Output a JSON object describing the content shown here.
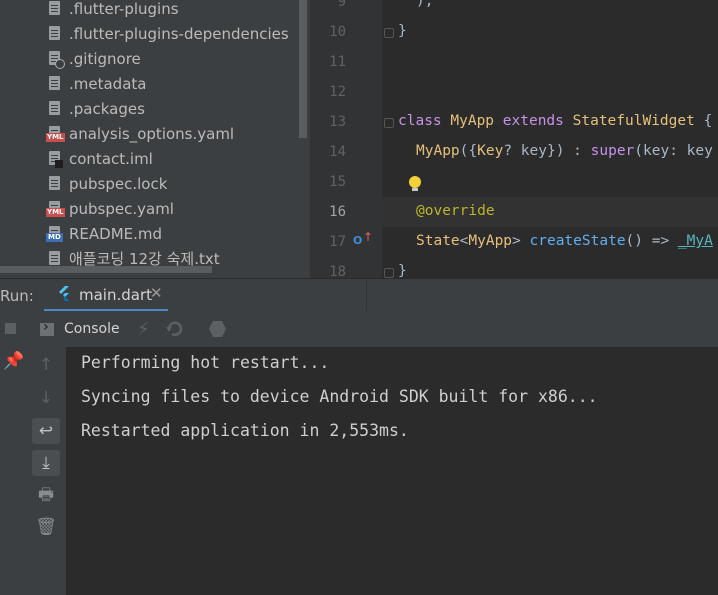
{
  "project_tree": {
    "items": [
      {
        "label": ".flutter-plugins",
        "icon": "file-icon"
      },
      {
        "label": ".flutter-plugins-dependencies",
        "icon": "file-icon"
      },
      {
        "label": ".gitignore",
        "icon": "gitignore-file-icon"
      },
      {
        "label": ".metadata",
        "icon": "file-icon"
      },
      {
        "label": ".packages",
        "icon": "file-icon"
      },
      {
        "label": "analysis_options.yaml",
        "icon": "yaml-file-icon"
      },
      {
        "label": "contact.iml",
        "icon": "iml-file-icon"
      },
      {
        "label": "pubspec.lock",
        "icon": "file-icon"
      },
      {
        "label": "pubspec.yaml",
        "icon": "yaml-file-icon"
      },
      {
        "label": "README.md",
        "icon": "markdown-file-icon"
      },
      {
        "label": "애플코딩 12강 숙제.txt",
        "icon": "text-file-icon"
      }
    ],
    "badges": {
      "yml": "YML",
      "md": "MD"
    }
  },
  "editor": {
    "line_numbers": [
      "9",
      "10",
      "11",
      "12",
      "13",
      "14",
      "15",
      "16",
      "17",
      "18"
    ],
    "code": {
      "l9": ");",
      "l10": "}",
      "l13_class": "class",
      "l13_name": "MyApp",
      "l13_extends": "extends",
      "l13_super": "StatefulWidget",
      "l13_brace": "{",
      "l14_ctor": "MyApp",
      "l14_open": "({",
      "l14_key": "Key",
      "l14_param": "? key}) : ",
      "l14_super": "super",
      "l14_rest": "(key: key",
      "l16": "@override",
      "l17_state": "State",
      "l17_lt": "<",
      "l17_myapp": "MyApp",
      "l17_gt": "> ",
      "l17_fn": "createState",
      "l17_arrow": "() => ",
      "l17_ret": "_MyA",
      "l18": "}"
    }
  },
  "run": {
    "label": "Run:",
    "tab_label": "main.dart",
    "tab_close": "✕",
    "console_label": "Console"
  },
  "console": {
    "lines": [
      "Performing hot restart...",
      "Syncing files to device Android SDK built for x86...",
      "Restarted application in 2,553ms."
    ]
  },
  "colors": {
    "background": "#2b2b2b",
    "panel": "#3c3f41",
    "accent": "#4a88c7",
    "keyword": "#cc7832",
    "type": "#e5c07b",
    "function": "#61afef",
    "annotation": "#bbb529",
    "bulb": "#f2d237"
  }
}
